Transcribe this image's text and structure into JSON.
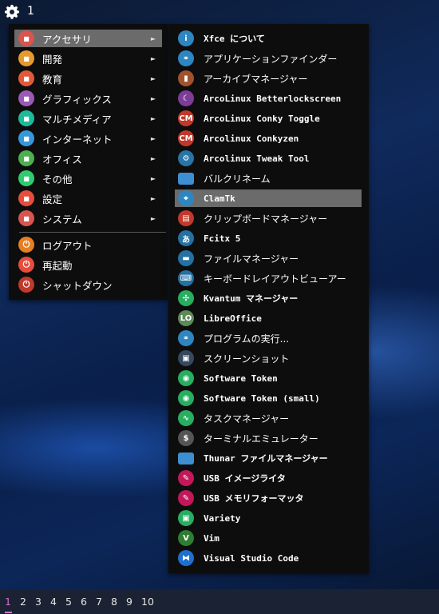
{
  "top_panel": {
    "workspace": "1",
    "menu_icon": "gear-icon"
  },
  "main_menu": {
    "items": [
      {
        "label": "アクセサリ",
        "icon": "accessories-icon",
        "color": "#d9534f",
        "arrow": "►"
      },
      {
        "label": "開発",
        "icon": "development-icon",
        "color": "#e69a2e",
        "arrow": "►"
      },
      {
        "label": "教育",
        "icon": "education-icon",
        "color": "#e05a3a",
        "arrow": "►"
      },
      {
        "label": "グラフィックス",
        "icon": "graphics-icon",
        "color": "#9b59b6",
        "arrow": "►"
      },
      {
        "label": "マルチメディア",
        "icon": "multimedia-icon",
        "color": "#1abc9c",
        "arrow": "►"
      },
      {
        "label": "インターネット",
        "icon": "internet-icon",
        "color": "#3498db",
        "arrow": "►"
      },
      {
        "label": "オフィス",
        "icon": "office-icon",
        "color": "#4caf50",
        "arrow": "►"
      },
      {
        "label": "その他",
        "icon": "other-icon",
        "color": "#2ecc71",
        "arrow": "►"
      },
      {
        "label": "設定",
        "icon": "settings-icon",
        "color": "#e74c3c",
        "arrow": "►"
      },
      {
        "label": "システム",
        "icon": "system-icon",
        "color": "#d9534f",
        "arrow": "►"
      }
    ],
    "session": [
      {
        "label": "ログアウト",
        "icon": "logout-icon",
        "color": "#e67e22"
      },
      {
        "label": "再起動",
        "icon": "restart-icon",
        "color": "#e74c3c"
      },
      {
        "label": "シャットダウン",
        "icon": "shutdown-icon",
        "color": "#c0392b"
      }
    ]
  },
  "submenu": {
    "items": [
      {
        "label": "Xfce について",
        "icon": "info-icon",
        "color": "#2e86c1",
        "glyph": "i"
      },
      {
        "label": "アプリケーションファインダー",
        "icon": "binoculars-icon",
        "color": "#2e86c1",
        "glyph": "⚭"
      },
      {
        "label": "アーカイブマネージャー",
        "icon": "archive-icon",
        "color": "#a0522d",
        "glyph": "▮"
      },
      {
        "label": "ArcoLinux Betterlockscreen",
        "icon": "lockscreen-icon",
        "color": "#7d3c98",
        "glyph": "☾"
      },
      {
        "label": "ArcoLinux Conky Toggle",
        "icon": "conky-icon",
        "color": "#c0392b",
        "glyph": "CM"
      },
      {
        "label": "Arcolinux Conkyzen",
        "icon": "conkyzen-icon",
        "color": "#c0392b",
        "glyph": "CM"
      },
      {
        "label": "Arcolinux Tweak Tool",
        "icon": "tweak-tool-icon",
        "color": "#2874a6",
        "glyph": "⚙"
      },
      {
        "label": "バルクリネーム",
        "icon": "folder-icon",
        "color": "#3d8fd1",
        "glyph": ""
      },
      {
        "label": "ClamTk",
        "icon": "clamtk-icon",
        "color": "#2e86c1",
        "glyph": "⌖"
      },
      {
        "label": "クリップボードマネージャー",
        "icon": "clipboard-icon",
        "color": "#c0392b",
        "glyph": "▤"
      },
      {
        "label": "Fcitx 5",
        "icon": "keyboard-input-icon",
        "color": "#2471a3",
        "glyph": "あ"
      },
      {
        "label": "ファイルマネージャー",
        "icon": "file-manager-icon",
        "color": "#2471a3",
        "glyph": "▬"
      },
      {
        "label": "キーボードレイアウトビューアー",
        "icon": "keyboard-icon",
        "color": "#2471a3",
        "glyph": "⌨"
      },
      {
        "label": "Kvantum マネージャー",
        "icon": "kvantum-icon",
        "color": "#27ae60",
        "glyph": "✣"
      },
      {
        "label": "LibreOffice",
        "icon": "libreoffice-icon",
        "color": "#5d8a58",
        "glyph": "LO"
      },
      {
        "label": "プログラムの実行...",
        "icon": "run-program-icon",
        "color": "#2e86c1",
        "glyph": "⚭"
      },
      {
        "label": "スクリーンショット",
        "icon": "screenshot-icon",
        "color": "#34495e",
        "glyph": "▣"
      },
      {
        "label": "Software Token",
        "icon": "software-token-icon",
        "color": "#27ae60",
        "glyph": "◉"
      },
      {
        "label": "Software Token (small)",
        "icon": "software-token-small-icon",
        "color": "#27ae60",
        "glyph": "◉"
      },
      {
        "label": "タスクマネージャー",
        "icon": "task-manager-icon",
        "color": "#27ae60",
        "glyph": "∿"
      },
      {
        "label": "ターミナルエミュレーター",
        "icon": "terminal-icon",
        "color": "#555555",
        "glyph": "$"
      },
      {
        "label": "Thunar ファイルマネージャー",
        "icon": "folder-icon",
        "color": "#3d8fd1",
        "glyph": ""
      },
      {
        "label": "USB イメージライタ",
        "icon": "usb-writer-icon",
        "color": "#c2185b",
        "glyph": "✎"
      },
      {
        "label": "USB メモリフォーマッタ",
        "icon": "usb-format-icon",
        "color": "#c2185b",
        "glyph": "✎"
      },
      {
        "label": "Variety",
        "icon": "variety-icon",
        "color": "#27ae60",
        "glyph": "▣"
      },
      {
        "label": "Vim",
        "icon": "vim-icon",
        "color": "#2e7d32",
        "glyph": "V"
      },
      {
        "label": "Visual Studio Code",
        "icon": "vscode-icon",
        "color": "#1f6fd1",
        "glyph": "⧓"
      }
    ],
    "active_index": 8
  },
  "bottom_panel": {
    "workspaces": [
      "1",
      "2",
      "3",
      "4",
      "5",
      "6",
      "7",
      "8",
      "9",
      "10"
    ],
    "current": 0
  }
}
